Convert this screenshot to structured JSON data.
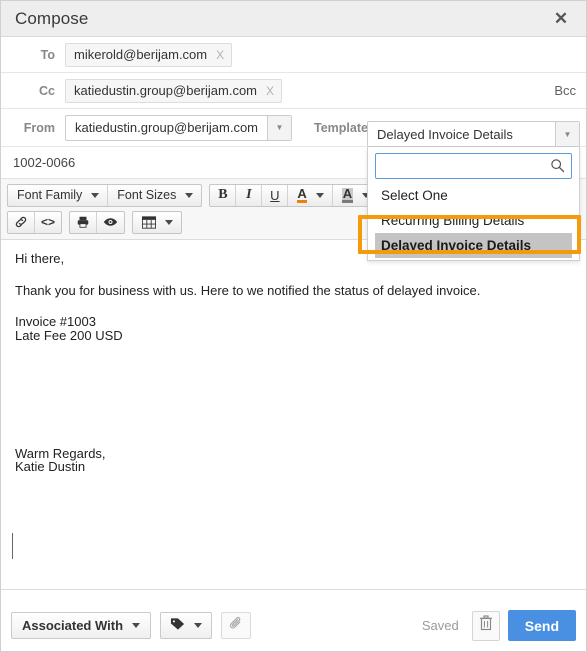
{
  "window": {
    "title": "Compose",
    "close_icon": "close-icon"
  },
  "recipients": {
    "to": {
      "label": "To",
      "chips": [
        {
          "value": "mikerold@berijam.com",
          "remove": "X"
        }
      ]
    },
    "cc": {
      "label": "Cc",
      "chips": [
        {
          "value": "katiedustin.group@berijam.com",
          "remove": "X"
        }
      ]
    },
    "bcc_label": "Bcc"
  },
  "from": {
    "label": "From",
    "value": "katiedustin.group@berijam.com",
    "arrow_icon": "chevron-down-icon"
  },
  "template": {
    "label": "Template",
    "selected": "Delayed Invoice Details",
    "arrow_icon": "chevron-down-icon",
    "search_value": "",
    "search_placeholder": "",
    "search_icon": "search-icon",
    "options": [
      "Select One",
      "Recurring Billing Details",
      "Delayed Invoice Details"
    ],
    "selected_index": 2,
    "highlight_color": "#f49a0b"
  },
  "subject": {
    "value": "1002-0066"
  },
  "toolbar": {
    "font_family": "Font Family",
    "font_sizes": "Font Sizes",
    "bold": "B",
    "italic": "I",
    "underline": "U",
    "text_color": "A",
    "highlight_color": "A",
    "link_icon": "link-icon",
    "code_icon": "code-icon",
    "print_icon": "print-icon",
    "preview_icon": "eye-icon",
    "table_icon": "table-icon"
  },
  "body": {
    "lines": [
      "Hi there,",
      "Thank you for business with us. Here to we notified the status of delayed invoice.",
      "Invoice #1003",
      "Late Fee 200 USD",
      "Warm Regards,",
      "Katie  Dustin"
    ]
  },
  "footer": {
    "associated_with": "Associated With",
    "tag_icon": "tag-icon",
    "attach_icon": "paperclip-icon",
    "saved_status": "Saved",
    "trash_icon": "trash-icon",
    "send_label": "Send",
    "send_color": "#4a90e2"
  }
}
